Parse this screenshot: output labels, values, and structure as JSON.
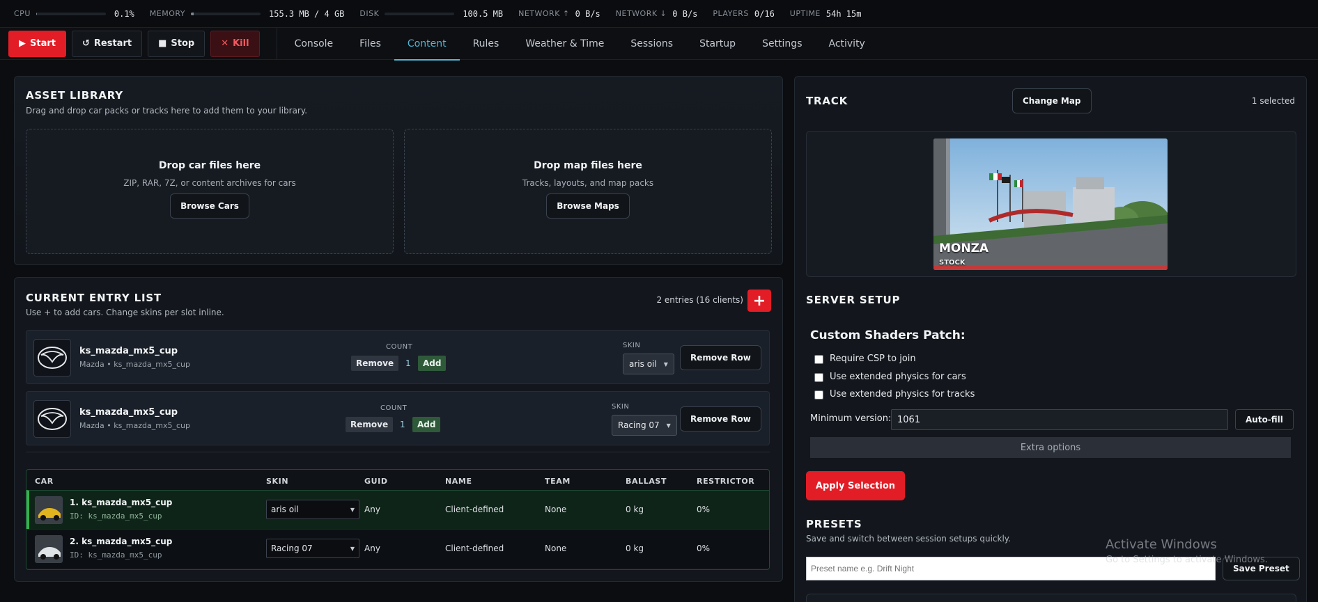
{
  "status": {
    "cpu": {
      "label": "CPU",
      "value": "0.1%",
      "level": 0.001
    },
    "memory": {
      "label": "MEMORY",
      "value": "155.3 MB / 4 GB",
      "level": 0.04
    },
    "disk": {
      "label": "DISK",
      "value": "100.5 MB",
      "level": 0.0
    },
    "net_up": {
      "label": "NETWORK ↑",
      "value": "0 B/s"
    },
    "net_down": {
      "label": "NETWORK ↓",
      "value": "0 B/s"
    },
    "players": {
      "label": "PLAYERS",
      "value": "0/16"
    },
    "uptime": {
      "label": "UPTIME",
      "value": "54h 15m"
    }
  },
  "controls": {
    "start": "Start",
    "restart": "Restart",
    "stop": "Stop",
    "kill": "Kill"
  },
  "tabs": [
    "Console",
    "Files",
    "Content",
    "Rules",
    "Weather & Time",
    "Sessions",
    "Startup",
    "Settings",
    "Activity"
  ],
  "active_tab": "Content",
  "asset_library": {
    "title": "ASSET LIBRARY",
    "subtitle": "Drag and drop car packs or tracks here to add them to your library.",
    "cars": {
      "title": "Drop car files here",
      "desc": "ZIP, RAR, 7Z, or content archives for cars",
      "button": "Browse Cars"
    },
    "maps": {
      "title": "Drop map files here",
      "desc": "Tracks, layouts, and map packs",
      "button": "Browse Maps"
    }
  },
  "entry_list": {
    "title": "CURRENT ENTRY LIST",
    "subtitle": "Use + to add cars. Change skins per slot inline.",
    "summary": "2 entries (16 clients)",
    "add_symbol": "+",
    "count_label": "COUNT",
    "skin_label": "SKIN",
    "remove": "Remove",
    "add": "Add",
    "remove_row": "Remove Row",
    "entries": [
      {
        "name": "ks_mazda_mx5_cup",
        "sub": "Mazda • ks_mazda_mx5_cup",
        "count": "1",
        "skin": "aris oil"
      },
      {
        "name": "ks_mazda_mx5_cup",
        "sub": "Mazda • ks_mazda_mx5_cup",
        "count": "1",
        "skin": "Racing 07"
      }
    ]
  },
  "table": {
    "headers": [
      "CAR",
      "SKIN",
      "GUID",
      "NAME",
      "TEAM",
      "BALLAST",
      "RESTRICTOR"
    ],
    "rows": [
      {
        "car": "1. ks_mazda_mx5_cup",
        "id": "ID: ks_mazda_mx5_cup",
        "skin": "aris oil",
        "guid": "Any",
        "name": "Client-defined",
        "team": "None",
        "ballast": "0 kg",
        "restrictor": "0%"
      },
      {
        "car": "2. ks_mazda_mx5_cup",
        "id": "ID: ks_mazda_mx5_cup",
        "skin": "Racing 07",
        "guid": "Any",
        "name": "Client-defined",
        "team": "None",
        "ballast": "0 kg",
        "restrictor": "0%"
      }
    ]
  },
  "track": {
    "title": "TRACK",
    "change_button": "Change Map",
    "selected": "1 selected",
    "name": "MONZA",
    "variant": "STOCK"
  },
  "server_setup": {
    "title": "SERVER SETUP",
    "csp_title": "Custom Shaders Patch:",
    "options": [
      "Require CSP to join",
      "Use extended physics for cars",
      "Use extended physics for tracks"
    ],
    "min_version_label": "Minimum version:",
    "min_version": "1061",
    "autofill": "Auto-fill",
    "extra": "Extra options",
    "apply": "Apply Selection"
  },
  "presets": {
    "title": "PRESETS",
    "subtitle": "Save and switch between session setups quickly.",
    "placeholder": "Preset name e.g. Drift Night",
    "save": "Save Preset"
  },
  "watermark": {
    "line1": "Activate Windows",
    "line2": "Go to Settings to activate Windows."
  },
  "colors": {
    "accent": "#e21d26",
    "tab_active": "#4fb6d6",
    "add_green": "#2f5a3a"
  }
}
